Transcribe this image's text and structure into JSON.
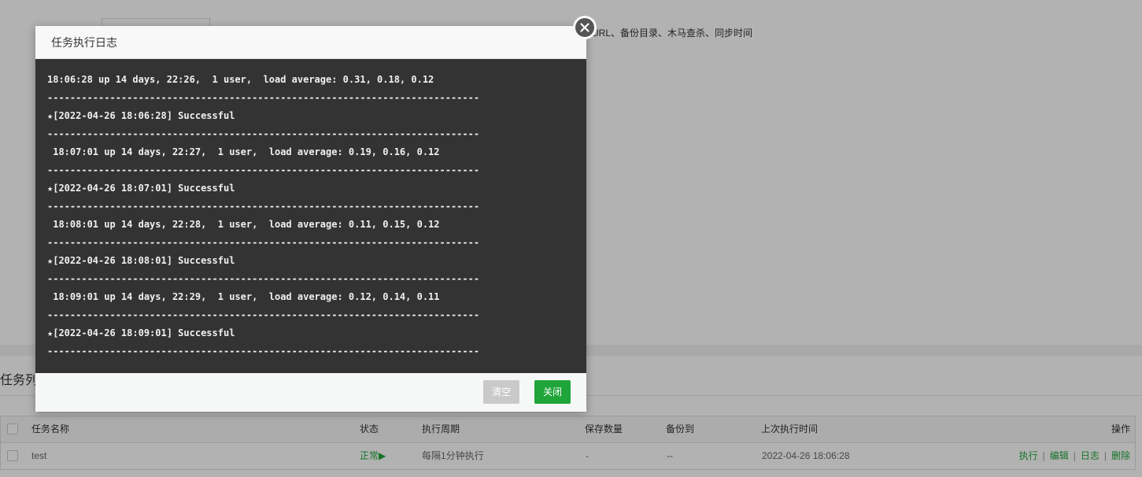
{
  "background": {
    "hint_text": "URL、备份目录、木马查杀、同步时间",
    "section_title": "任务列表",
    "table": {
      "headers": [
        "任务名称",
        "状态",
        "执行周期",
        "保存数量",
        "备份到",
        "上次执行时间",
        "操作"
      ],
      "row": {
        "name": "test",
        "status": "正常▶",
        "period": "每隔1分钟执行",
        "save_count": "-",
        "backup_to": "--",
        "last_run": "2022-04-26 18:06:28",
        "actions": [
          "执行",
          "编辑",
          "日志",
          "删除"
        ]
      }
    }
  },
  "modal": {
    "title": "任务执行日志",
    "log_lines": [
      "18:06:28 up 14 days, 22:26,  1 user,  load average: 0.31, 0.18, 0.12",
      "----------------------------------------------------------------------------",
      "★[2022-04-26 18:06:28] Successful",
      "----------------------------------------------------------------------------",
      " 18:07:01 up 14 days, 22:27,  1 user,  load average: 0.19, 0.16, 0.12",
      "----------------------------------------------------------------------------",
      "★[2022-04-26 18:07:01] Successful",
      "----------------------------------------------------------------------------",
      " 18:08:01 up 14 days, 22:28,  1 user,  load average: 0.11, 0.15, 0.12",
      "----------------------------------------------------------------------------",
      "★[2022-04-26 18:08:01] Successful",
      "----------------------------------------------------------------------------",
      " 18:09:01 up 14 days, 22:29,  1 user,  load average: 0.12, 0.14, 0.11",
      "----------------------------------------------------------------------------",
      "★[2022-04-26 18:09:01] Successful",
      "----------------------------------------------------------------------------"
    ],
    "buttons": {
      "clear": "清空",
      "close": "关闭"
    }
  },
  "colors": {
    "accent": "#20a53a",
    "log_bg": "#333333",
    "disabled": "#c9c9c9"
  },
  "icons": {
    "dialog_close": "close-circle-icon"
  }
}
